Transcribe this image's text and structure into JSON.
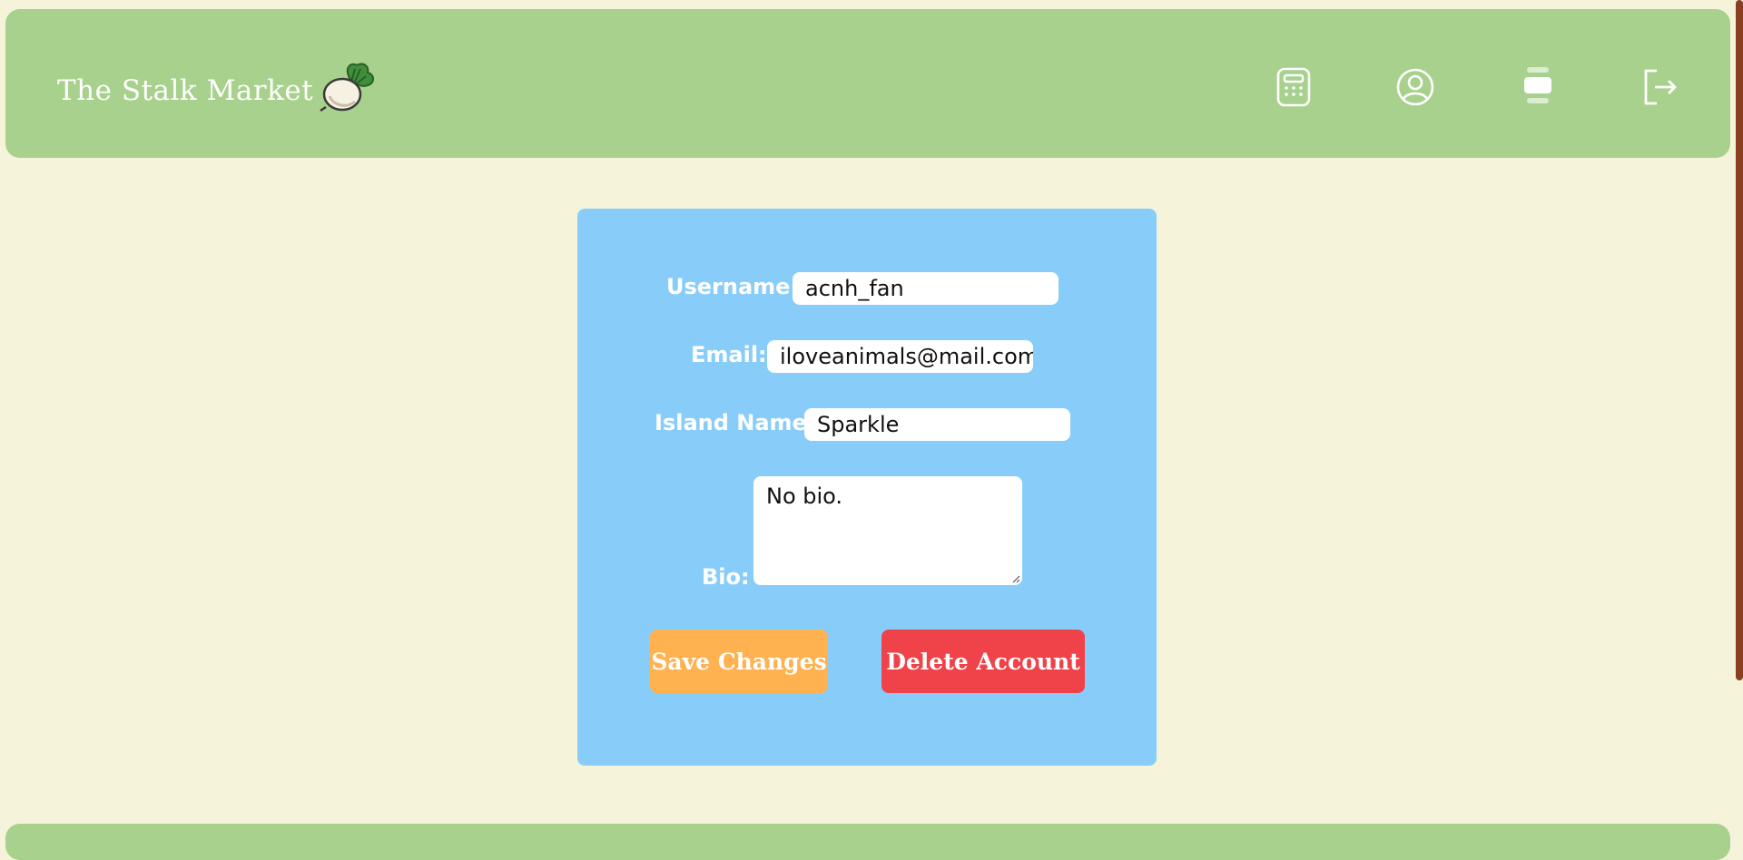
{
  "header": {
    "title": "The Stalk Market",
    "logo_icon": "turnip-icon",
    "nav": [
      {
        "icon": "calculator-icon"
      },
      {
        "icon": "profile-icon"
      },
      {
        "icon": "marketplace-icon"
      },
      {
        "icon": "logout-icon"
      }
    ]
  },
  "form": {
    "username_label": "Username:",
    "username_value": "acnh_fan",
    "email_label": "Email:",
    "email_value": "iloveanimals@mail.com",
    "island_label": "Island Name:",
    "island_value": "Sparkle",
    "bio_label": "Bio:",
    "bio_value": "No bio.",
    "save_label": "Save Changes",
    "delete_label": "Delete Account"
  },
  "colors": {
    "background": "#f5f3da",
    "header": "#a8d18d",
    "card": "#88cdfa",
    "save_button": "#ffb24f",
    "delete_button": "#ef4249",
    "scrollbar": "#8b3f22"
  }
}
